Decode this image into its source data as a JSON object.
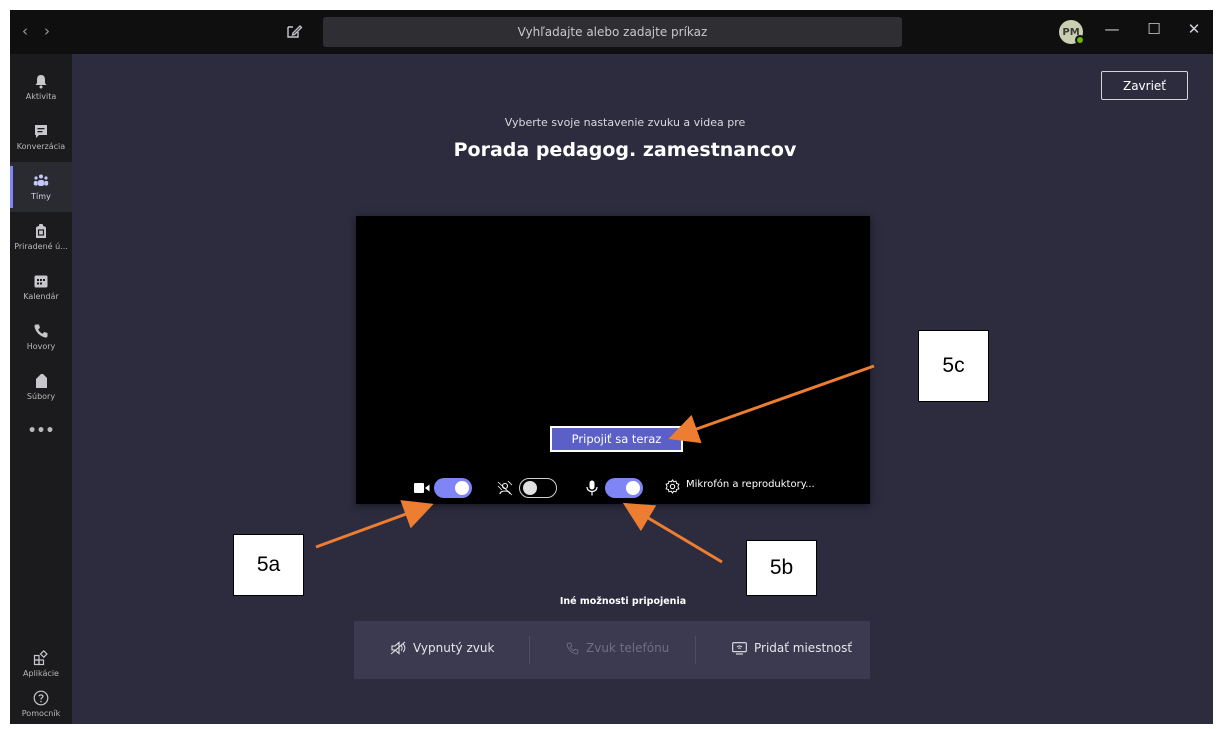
{
  "titlebar": {
    "search_placeholder": "Vyhľadajte alebo zadajte príkaz",
    "avatar_initials": "PM",
    "back_icon": "chevron-left-icon",
    "forward_icon": "chevron-right-icon",
    "compose_icon": "compose-icon",
    "minimize": "—",
    "maximize": "☐",
    "close": "✕"
  },
  "rail": {
    "items": [
      {
        "label": "Aktivita",
        "icon": "bell-icon"
      },
      {
        "label": "Konverzácia",
        "icon": "chat-icon"
      },
      {
        "label": "Tímy",
        "icon": "teams-icon",
        "active": true
      },
      {
        "label": "Priradené ú...",
        "icon": "assignments-icon"
      },
      {
        "label": "Kalendár",
        "icon": "calendar-icon"
      },
      {
        "label": "Hovory",
        "icon": "phone-icon"
      },
      {
        "label": "Súbory",
        "icon": "file-icon"
      }
    ],
    "more": "•••",
    "bottom": [
      {
        "label": "Aplikácie",
        "icon": "apps-icon"
      },
      {
        "label": "Pomocník",
        "icon": "help-icon"
      }
    ]
  },
  "main": {
    "close_label": "Zavrieť",
    "subtitle": "Vyberte svoje nastavenie zvuku a videa pre",
    "meeting_title": "Porada pedagog. zamestnancov",
    "join_label": "Pripojiť sa teraz",
    "controls": {
      "camera_on": true,
      "background_blur_on": false,
      "mic_on": true,
      "audio_settings_label": "Mikrofón a reproduktory..."
    },
    "other_options_label": "Iné možnosti pripojenia",
    "other_options": [
      {
        "label": "Vypnutý zvuk",
        "icon": "speaker-off-icon",
        "enabled": true
      },
      {
        "label": "Zvuk telefónu",
        "icon": "phone-icon",
        "enabled": false
      },
      {
        "label": "Pridať miestnosť",
        "icon": "room-display-icon",
        "enabled": true
      }
    ]
  },
  "annotations": {
    "a": "5a",
    "b": "5b",
    "c": "5c",
    "arrow_color": "#ed7d31"
  },
  "colors": {
    "background": "#2d2c3f",
    "accent": "#7f85f5",
    "join_button": "#5b5fc7"
  }
}
